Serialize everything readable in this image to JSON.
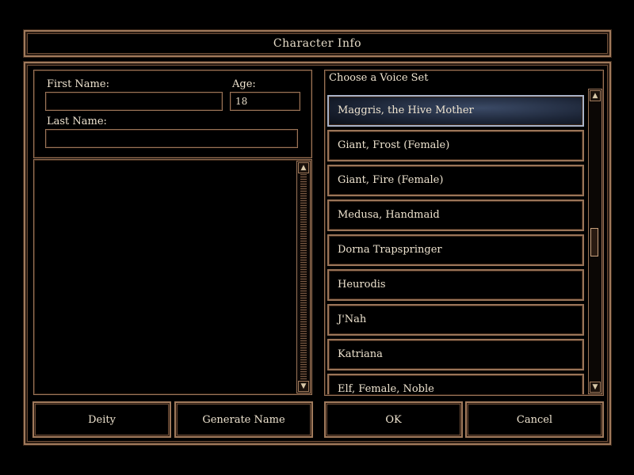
{
  "window": {
    "title": "Character Info"
  },
  "name_panel": {
    "first_name_label": "First Name:",
    "first_name_value": "",
    "age_label": "Age:",
    "age_value": "18",
    "last_name_label": "Last Name:",
    "last_name_value": ""
  },
  "voice_panel": {
    "header": "Choose a Voice Set",
    "items": [
      {
        "label": "Maggris, the Hive Mother",
        "selected": true
      },
      {
        "label": "Giant, Frost (Female)",
        "selected": false
      },
      {
        "label": "Giant, Fire (Female)",
        "selected": false
      },
      {
        "label": "Medusa, Handmaid",
        "selected": false
      },
      {
        "label": "Dorna Trapspringer",
        "selected": false
      },
      {
        "label": "Heurodis",
        "selected": false
      },
      {
        "label": "J'Nah",
        "selected": false
      },
      {
        "label": "Katriana",
        "selected": false
      },
      {
        "label": "Elf, Female, Noble",
        "selected": false
      }
    ],
    "scroll_position": 0.5
  },
  "buttons": {
    "deity": "Deity",
    "generate_name": "Generate Name",
    "ok": "OK",
    "cancel": "Cancel"
  },
  "icons": {
    "scroll_up": "scroll-up-arrow-icon",
    "scroll_down": "scroll-down-arrow-icon"
  },
  "colors": {
    "frame": "#a07a5c",
    "selected_item": "#1d2638",
    "text": "#eee3cf"
  }
}
